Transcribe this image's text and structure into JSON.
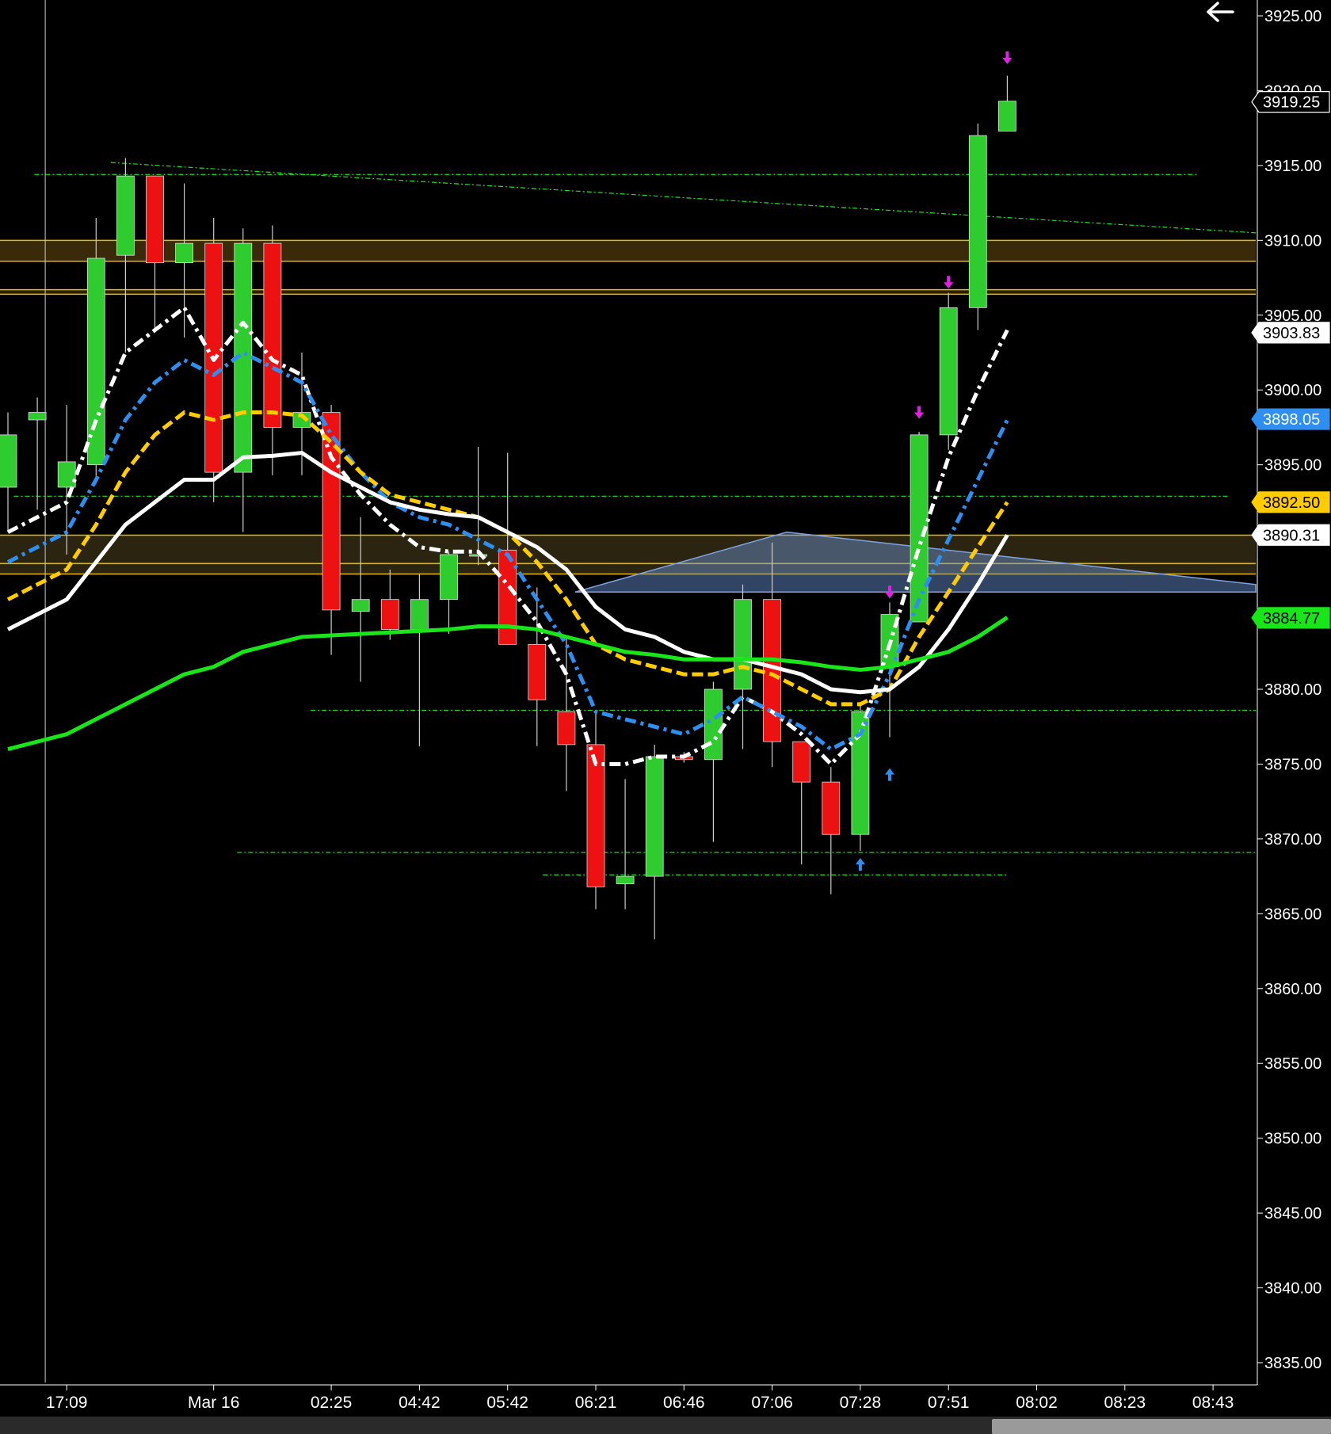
{
  "chart_data": {
    "type": "candlestick",
    "y_axis": {
      "min": 3833.5,
      "max": 3926,
      "ticks": [
        "3925.00",
        "3920.00",
        "3915.00",
        "3910.00",
        "3905.00",
        "3900.00",
        "3895.00",
        "3890.00",
        "3885.00",
        "3880.00",
        "3875.00",
        "3870.00",
        "3865.00",
        "3860.00",
        "3855.00",
        "3850.00",
        "3845.00",
        "3840.00",
        "3835.00"
      ],
      "tick_values": [
        3925,
        3920,
        3915,
        3910,
        3905,
        3900,
        3895,
        3890,
        3885,
        3880,
        3875,
        3870,
        3865,
        3860,
        3855,
        3850,
        3845,
        3840,
        3835
      ]
    },
    "x_axis": {
      "labels": [
        {
          "text": "17:09",
          "bar": 2
        },
        {
          "text": "Mar 16",
          "bar": 7
        },
        {
          "text": "02:25",
          "bar": 11
        },
        {
          "text": "04:42",
          "bar": 14
        },
        {
          "text": "05:42",
          "bar": 17
        },
        {
          "text": "06:21",
          "bar": 20
        },
        {
          "text": "06:46",
          "bar": 23
        },
        {
          "text": "07:06",
          "bar": 26
        },
        {
          "text": "07:28",
          "bar": 29
        },
        {
          "text": "07:51",
          "bar": 32
        },
        {
          "text": "08:02",
          "bar": 35
        },
        {
          "text": "08:23",
          "bar": 38
        },
        {
          "text": "08:43",
          "bar": 41
        }
      ],
      "bar_range": [
        -0.25,
        42.5
      ]
    },
    "candles": [
      {
        "o": 3893.5,
        "h": 3898.5,
        "l": 3890.5,
        "c": 3897.0
      },
      {
        "o": 3898.0,
        "h": 3899.5,
        "l": 3892.0,
        "c": 3898.5
      },
      {
        "o": 3893.5,
        "h": 3899.0,
        "l": 3889.0,
        "c": 3895.2
      },
      {
        "o": 3895.0,
        "h": 3911.5,
        "l": 3894.0,
        "c": 3908.8
      },
      {
        "o": 3909.0,
        "h": 3915.5,
        "l": 3902.5,
        "c": 3914.3
      },
      {
        "o": 3914.3,
        "h": 3914.3,
        "l": 3904.0,
        "c": 3908.5
      },
      {
        "o": 3908.5,
        "h": 3913.8,
        "l": 3903.5,
        "c": 3909.8
      },
      {
        "o": 3909.8,
        "h": 3911.5,
        "l": 3892.5,
        "c": 3894.5
      },
      {
        "o": 3894.5,
        "h": 3910.8,
        "l": 3890.5,
        "c": 3909.8
      },
      {
        "o": 3909.8,
        "h": 3911.0,
        "l": 3894.3,
        "c": 3897.5
      },
      {
        "o": 3897.5,
        "h": 3902.5,
        "l": 3894.3,
        "c": 3898.5
      },
      {
        "o": 3898.5,
        "h": 3899.0,
        "l": 3882.3,
        "c": 3885.3
      },
      {
        "o": 3885.2,
        "h": 3891.5,
        "l": 3880.5,
        "c": 3886.0
      },
      {
        "o": 3886.0,
        "h": 3888.0,
        "l": 3883.3,
        "c": 3884.0
      },
      {
        "o": 3884.0,
        "h": 3887.7,
        "l": 3876.2,
        "c": 3886.0
      },
      {
        "o": 3886.0,
        "h": 3889.2,
        "l": 3883.7,
        "c": 3889.0
      },
      {
        "o": 3889.0,
        "h": 3896.2,
        "l": 3888.3,
        "c": 3889.0
      },
      {
        "o": 3889.3,
        "h": 3895.8,
        "l": 3883.7,
        "c": 3883.0
      },
      {
        "o": 3883.0,
        "h": 3886.8,
        "l": 3876.2,
        "c": 3879.3
      },
      {
        "o": 3878.5,
        "h": 3883.5,
        "l": 3873.2,
        "c": 3876.3
      },
      {
        "o": 3876.3,
        "h": 3878.5,
        "l": 3865.3,
        "c": 3866.8
      },
      {
        "o": 3867.0,
        "h": 3874.0,
        "l": 3865.3,
        "c": 3867.5
      },
      {
        "o": 3867.5,
        "h": 3876.3,
        "l": 3863.3,
        "c": 3875.5
      },
      {
        "o": 3875.5,
        "h": 3875.8,
        "l": 3875.1,
        "c": 3875.3
      },
      {
        "o": 3875.3,
        "h": 3880.5,
        "l": 3869.8,
        "c": 3880.0
      },
      {
        "o": 3880.0,
        "h": 3887.0,
        "l": 3876.0,
        "c": 3886.0
      },
      {
        "o": 3886.0,
        "h": 3889.8,
        "l": 3874.8,
        "c": 3876.5
      },
      {
        "o": 3876.5,
        "h": 3876.5,
        "l": 3868.3,
        "c": 3873.8
      },
      {
        "o": 3873.8,
        "h": 3874.8,
        "l": 3866.3,
        "c": 3870.3
      },
      {
        "o": 3870.3,
        "h": 3879.0,
        "l": 3869.2,
        "c": 3878.5
      },
      {
        "o": 3881.5,
        "h": 3885.8,
        "l": 3876.8,
        "c": 3885.0
      },
      {
        "o": 3884.5,
        "h": 3897.2,
        "l": 3884.5,
        "c": 3897.0
      },
      {
        "o": 3897.0,
        "h": 3906.5,
        "l": 3896.0,
        "c": 3905.5
      },
      {
        "o": 3905.5,
        "h": 3917.8,
        "l": 3904.0,
        "c": 3917.0
      },
      {
        "o": 3917.3,
        "h": 3921.0,
        "l": 3917.3,
        "c": 3919.3
      }
    ],
    "series": [
      {
        "color": "#ffffff",
        "style": "dashdot",
        "values": [
          3890.5,
          3891.5,
          3892.5,
          3898.0,
          3902.5,
          3904.0,
          3905.5,
          3902.0,
          3904.5,
          3902.0,
          3901.0,
          3895.5,
          3893.0,
          3891.0,
          3889.5,
          3889.2,
          3889.2,
          3887.0,
          3884.5,
          3881.0,
          3875.0,
          3875.0,
          3875.5,
          3875.5,
          3876.5,
          3879.5,
          3878.5,
          3877.0,
          3875.0,
          3877.0,
          3883.0,
          3889.5,
          3895.5,
          3900.0,
          3904.0
        ]
      },
      {
        "color": "#2e8ff0",
        "style": "dashdot",
        "values": [
          3888.5,
          3889.5,
          3890.5,
          3894.0,
          3898.0,
          3900.5,
          3902.0,
          3901.0,
          3902.5,
          3901.5,
          3900.5,
          3897.0,
          3894.5,
          3892.5,
          3891.5,
          3891.0,
          3890.0,
          3889.0,
          3886.0,
          3883.0,
          3878.5,
          3878.0,
          3877.5,
          3877.0,
          3878.0,
          3879.5,
          3878.5,
          3877.5,
          3876.0,
          3877.0,
          3881.0,
          3886.0,
          3890.0,
          3894.0,
          3898.0
        ]
      },
      {
        "color": "#ffcc00",
        "style": "dashed",
        "values": [
          3886.0,
          3887.0,
          3888.0,
          3891.0,
          3894.5,
          3897.0,
          3898.5,
          3898.0,
          3898.5,
          3898.5,
          3898.3,
          3896.5,
          3894.5,
          3893.0,
          3892.5,
          3892.0,
          3891.5,
          3890.5,
          3888.5,
          3886.0,
          3883.0,
          3882.0,
          3881.5,
          3881.0,
          3881.0,
          3881.5,
          3881.0,
          3880.0,
          3879.0,
          3879.0,
          3880.0,
          3883.5,
          3886.5,
          3889.5,
          3892.5
        ]
      },
      {
        "color": "#ffffff",
        "style": "solid",
        "values": [
          3884.0,
          3885.0,
          3886.0,
          3888.5,
          3891.0,
          3892.5,
          3894.0,
          3894.0,
          3895.5,
          3895.6,
          3895.8,
          3894.5,
          3893.5,
          3892.5,
          3892.0,
          3891.7,
          3891.5,
          3890.5,
          3889.5,
          3888.0,
          3885.5,
          3884.0,
          3883.5,
          3882.5,
          3882.0,
          3882.0,
          3881.5,
          3881.0,
          3880.0,
          3879.8,
          3880.0,
          3881.5,
          3884.0,
          3887.0,
          3890.3
        ]
      },
      {
        "color": "#19e619",
        "style": "solid",
        "values": [
          3876.0,
          3876.5,
          3877.0,
          3878.0,
          3879.0,
          3880.0,
          3881.0,
          3881.5,
          3882.5,
          3883.0,
          3883.5,
          3883.6,
          3883.7,
          3883.8,
          3883.9,
          3884.0,
          3884.2,
          3884.2,
          3884.0,
          3883.5,
          3883.0,
          3882.5,
          3882.3,
          3882.0,
          3882.0,
          3882.0,
          3882.0,
          3881.8,
          3881.5,
          3881.3,
          3881.5,
          3882.0,
          3882.5,
          3883.5,
          3884.8
        ]
      }
    ],
    "zones": [
      {
        "top": 3910.0,
        "bottom": 3908.6,
        "color": "#3a2a0a",
        "border": "#e6b800"
      },
      {
        "top": 3906.7,
        "bottom": 3906.4,
        "color": "#2a2008",
        "border": "#e6b800"
      },
      {
        "top": 3890.3,
        "bottom": 3888.4,
        "color": "#2b2410",
        "border": "#e6b800"
      },
      {
        "top": 3888.4,
        "bottom": 3887.7,
        "color": "#2b2410",
        "border": "#e6b800"
      }
    ],
    "h_levels": [
      {
        "y": 3914.4,
        "from_bar": 0.9,
        "to_bar": 40.5
      },
      {
        "y": 3892.9,
        "from_bar": 0.2,
        "to_bar": 41.5
      },
      {
        "y": 3878.6,
        "from_bar": 10.3,
        "to_bar": 42.5
      },
      {
        "y": 3869.1,
        "from_bar": 7.8,
        "to_bar": 42.5
      },
      {
        "y": 3867.6,
        "from_bar": 18.2,
        "to_bar": 34.0
      }
    ],
    "trendline": {
      "x1": 3.5,
      "y1": 3915.2,
      "x2": 42.5,
      "y2": 3910.5
    },
    "triangle": {
      "points": [
        [
          19.3,
          3886.5
        ],
        [
          26.5,
          3890.5
        ],
        [
          42.5,
          3887.0
        ],
        [
          42.5,
          3886.5
        ]
      ]
    },
    "price_tags": [
      {
        "text": "3919.25",
        "value": 3919.25,
        "bg": "#000000",
        "fg": "#ffffff",
        "border": "#ffffff"
      },
      {
        "text": "3903.83",
        "value": 3903.83,
        "bg": "#ffffff",
        "fg": "#000000",
        "border": "#ffffff"
      },
      {
        "text": "3898.05",
        "value": 3898.05,
        "bg": "#2e8ff0",
        "fg": "#ffffff",
        "border": "#2e8ff0"
      },
      {
        "text": "3892.50",
        "value": 3892.5,
        "bg": "#ffcc00",
        "fg": "#000000",
        "border": "#ffcc00"
      },
      {
        "text": "3890.31",
        "value": 3890.31,
        "bg": "#ffffff",
        "fg": "#000000",
        "border": "#ffffff"
      },
      {
        "text": "3884.77",
        "value": 3884.77,
        "bg": "#19e619",
        "fg": "#000000",
        "border": "#19e619"
      }
    ],
    "markers": [
      {
        "bar": 34,
        "value": 3922.2,
        "type": "down",
        "color": "#e61ee6"
      },
      {
        "bar": 32,
        "value": 3907.2,
        "type": "down",
        "color": "#e61ee6"
      },
      {
        "bar": 31,
        "value": 3898.5,
        "type": "down",
        "color": "#e61ee6"
      },
      {
        "bar": 30,
        "value": 3886.5,
        "type": "down",
        "color": "#e61ee6"
      },
      {
        "bar": 30,
        "value": 3874.3,
        "type": "up",
        "color": "#2e8ff0"
      },
      {
        "bar": 29,
        "value": 3868.3,
        "type": "up",
        "color": "#2e8ff0"
      }
    ],
    "cursor_bar": 1.0
  },
  "ui": {
    "back_icon": "back-arrow-icon"
  }
}
